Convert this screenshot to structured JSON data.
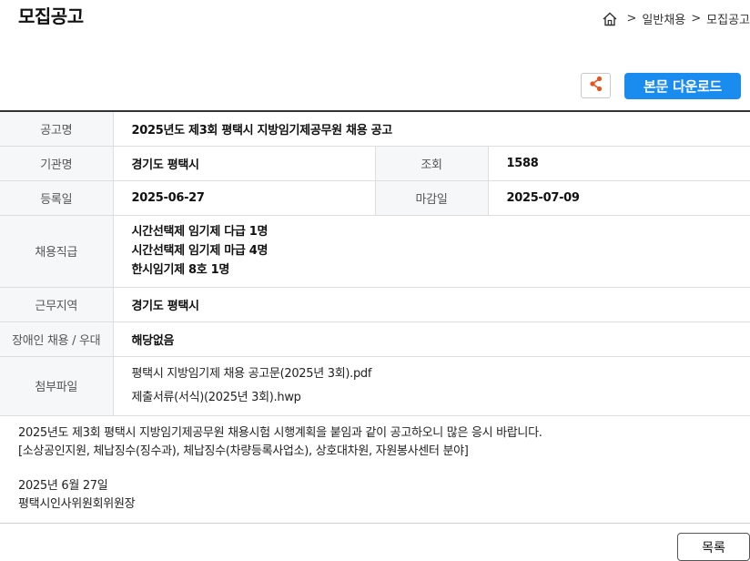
{
  "page": {
    "title": "모집공고"
  },
  "breadcrumb": {
    "sep": ">",
    "items": [
      "일반채용",
      "모집공고"
    ]
  },
  "toolbar": {
    "share_icon": "share-icon",
    "download_label": "본문 다운로드",
    "accent": "#1a8cf0",
    "share_color": "#e8531d"
  },
  "info": {
    "notice_name_label": "공고명",
    "notice_name": "2025년도 제3회 평택시 지방임기제공무원 채용 공고",
    "agency_label": "기관명",
    "agency": "경기도 평택시",
    "views_label": "조회",
    "views": "1588",
    "reg_date_label": "등록일",
    "reg_date": "2025-06-27",
    "deadline_label": "마감일",
    "deadline": "2025-07-09",
    "position_label": "채용직급",
    "positions": [
      "시간선택제 임기제 다급 1명",
      "시간선택제 임기제 마급 4명",
      "한시임기제 8호 1명"
    ],
    "work_area_label": "근무지역",
    "work_area": "경기도 평택시",
    "disability_label": "장애인 채용 / 우대",
    "disability": "해당없음",
    "attachments_label": "첨부파일",
    "attachments": [
      "평택시 지방임기제 채용 공고문(2025년 3회).pdf",
      "제출서류(서식)(2025년 3회).hwp"
    ]
  },
  "notice": {
    "line1": "2025년도 제3회 평택시 지방임기제공무원 채용시험 시행계획을 붙임과 같이 공고하오니 많은 응시 바랍니다.",
    "line2": "[소상공인지원, 체납징수(징수과), 체납징수(차량등록사업소), 상호대차원, 자원봉사센터 분야]",
    "date": "2025년 6월 27일",
    "signer": "평택시인사위원회위원장"
  },
  "footer": {
    "list_label": "목록"
  }
}
